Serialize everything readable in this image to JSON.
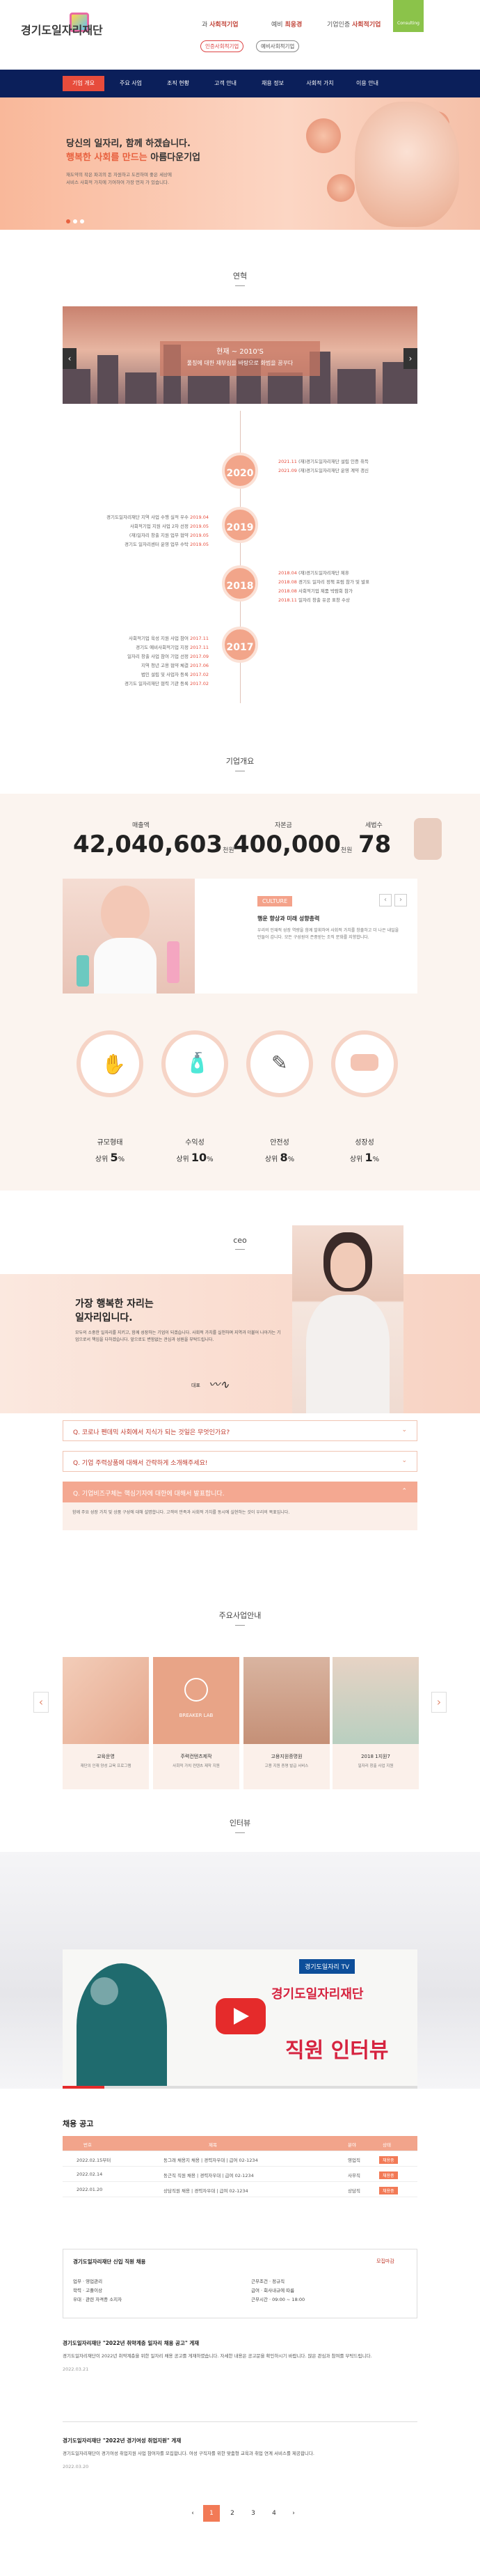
{
  "header": {
    "logo_text": "경기도일자리재단",
    "links": [
      {
        "label": "과",
        "strong": "사회적기업"
      },
      {
        "label": "예비",
        "strong": "최웅경"
      },
      {
        "label": "기업인증",
        "strong": "사회적기업"
      }
    ],
    "btn_certify": "인증사회적기업",
    "btn_prelim": "예비사회적기업",
    "consult_label": "Consulting"
  },
  "nav": {
    "items": [
      "기업 개요",
      "주요 사업",
      "조직 현황",
      "고객 안내",
      "채용 정보",
      "사회적 가치",
      "이용 안내"
    ]
  },
  "hero": {
    "line1": "당신의 일자리, 함께 하겠습니다.",
    "line2_accent": "행복한 사회를 만드는",
    "line2_rest": " 아름다운기업",
    "desc1": "재도약의 작은 파괴의 돈 자원하고 도전하며 좋은 세상에",
    "desc2": "서비스 사회적 가치에 기여하여 가장 먼저 가 있습니다."
  },
  "timeline": {
    "section_title": "연혁",
    "banner_title": "현재 ~ 2010'S",
    "banner_sub": "풀칭에 대한 재부심을 바탕으로 화범을 꿈꾸다",
    "years": [
      "2020",
      "2019",
      "2018",
      "2017"
    ],
    "events_2020": [
      {
        "date": "2021.11",
        "text": "(재)경기도일자리재단 설립 인증 취득"
      },
      {
        "date": "2021.09",
        "text": "(재)경기도일자리재단 운영 계약 갱신"
      }
    ],
    "events_2019": [
      {
        "date": "2019.04",
        "text": "경기도일자리재단 지역 사업 수행 실적 우수"
      },
      {
        "date": "2019.05",
        "text": "사회적기업 지원 사업 2차 선정"
      },
      {
        "date": "2019.05",
        "text": "(재)일자리 창출 지원 업무 협약"
      },
      {
        "date": "2019.05",
        "text": "경기도 일자리센터 운영 업무 수탁"
      }
    ],
    "events_2018": [
      {
        "date": "2018.04",
        "text": "(재)경기도일자리재단 제휴"
      },
      {
        "date": "2018.08",
        "text": "경기도 일자리 정책 포럼 참가 및 발표"
      },
      {
        "date": "2018.08",
        "text": "사회적기업 제품 박람회 참가"
      },
      {
        "date": "2018.11",
        "text": "일자리 창출 유공 표창 수상"
      }
    ],
    "events_2017": [
      {
        "date": "2017.11",
        "text": "사회적기업 육성 지원 사업 참여"
      },
      {
        "date": "2017.11",
        "text": "경기도 예비사회적기업 지정"
      },
      {
        "date": "2017.09",
        "text": "일자리 창출 사업 참여 기업 선정"
      },
      {
        "date": "2017.06",
        "text": "지역 청년 고용 협약 체결"
      },
      {
        "date": "2017.02",
        "text": "법인 설립 및 사업자 등록"
      },
      {
        "date": "2017.02",
        "text": "경기도 일자리재단 협력 기관 등록"
      }
    ]
  },
  "overview": {
    "section_title": "기업개요",
    "stats": [
      {
        "label": "매출액",
        "value": "42,040,603",
        "unit": "천원"
      },
      {
        "label": "자본금",
        "value": "400,000",
        "unit": "천원"
      },
      {
        "label": "세법수",
        "value": "78",
        "unit": ""
      }
    ],
    "culture_tag": "CULTURE",
    "culture_title": "행운 향상과 미래 성향총력",
    "culture_desc": "우리의 인재적 성장 역량을 함께 발휘하여 사회적 가치를 창출하고 더 나은 내일을 만들어 갑니다. 모든 구성원이 존중받는 조직 문화를 지향합니다.",
    "mini": [
      {
        "label": "규모형태",
        "value": "5",
        "unit": "%",
        "prefix": "상위"
      },
      {
        "label": "수익성",
        "value": "10",
        "unit": "%",
        "prefix": "상위"
      },
      {
        "label": "안전성",
        "value": "8",
        "unit": "%",
        "prefix": "상위"
      },
      {
        "label": "성장성",
        "value": "1",
        "unit": "%",
        "prefix": "상위"
      }
    ]
  },
  "ceo": {
    "section_title": "ceo",
    "headline1": "가장 행복한 자리는",
    "headline2": "일자리입니다.",
    "body": "모두의 소중한 일자리를 지키고, 함께 성장하는 기업이 되겠습니다. 사회적 가치를 실천하며 지역과 더불어 나아가는 기업으로서 책임을 다하겠습니다. 앞으로도 변함없는 관심과 성원을 부탁드립니다.",
    "sign_label": "대표",
    "qa": [
      {
        "q": "Q. 코로나 펜데믹 사회에서 지식가 되는 것일은 무엇인가요?",
        "open": false
      },
      {
        "q": "Q. 기업 주력상품에 대해서 간략하게 소개해주세요!",
        "open": false
      },
      {
        "q": "Q. 기업비즈구체는 핵심기자에 대한에 대해서 발표합니다.",
        "open": true
      }
    ],
    "qa_answer": "함께 주요 성장 가치 및 상품 구성에 대해 설명합니다. 고객의 만족과 사회적 가치를 동시에 실현하는 것이 우리의 목표입니다."
  },
  "business": {
    "section_title": "주요사업안내",
    "items": [
      {
        "title": "교육운영",
        "desc": "재단의 인재 양성 교육 프로그램"
      },
      {
        "title": "주력컨텐츠제작",
        "desc": "사회적 가치 컨텐츠 제작 지원"
      },
      {
        "title": "고용지원증명원",
        "desc": "고용 지원 증명 발급 서비스"
      },
      {
        "title": "2018 1지원7",
        "desc": "일자리 창출 사업 지원"
      }
    ],
    "lab_label": "BREAKER LAB"
  },
  "interview": {
    "section_title": "인터뷰",
    "video_caption1": "경기도일자리재단",
    "video_caption2": "직원 인터뷰",
    "video_badge": "경기도일자리 TV"
  },
  "jobs": {
    "title": "채용 공고",
    "headers": [
      "번호",
      "제목",
      "분야",
      "상태"
    ],
    "rows": [
      {
        "no": "2022.02.15부터",
        "title": "동그래 채용지 채용 | 경력자우대 | 급여 02-1234",
        "field": "영업직",
        "status": "채용중"
      },
      {
        "no": "2022.02.14",
        "title": "동근직 직원 채용 | 경력자우대 | 급여 02-1234",
        "field": "사무직",
        "status": "채용중"
      },
      {
        "no": "2022.01.20",
        "title": "상담직원 채용 | 경력자우대 | 급여 02-1234",
        "field": "상담직",
        "status": "채용중"
      }
    ],
    "detail_title": "경기도일자리재단 신입 직원 채용",
    "detail_status": "모집마감",
    "detail_left": [
      {
        "k": "업무",
        "v": "영업관리"
      },
      {
        "k": "학력",
        "v": "고졸이상"
      },
      {
        "k": "우대",
        "v": "관련 자격증 소지자"
      }
    ],
    "detail_right": [
      {
        "k": "근무조건",
        "v": "정규직"
      },
      {
        "k": "급여",
        "v": "회사내규에 따름"
      },
      {
        "k": "근무시간",
        "v": "09:00 ~ 18:00"
      }
    ],
    "news": [
      {
        "title": "경기도일자리재단 \"2022년 취약계층 일자리 채용 공고\" 게재",
        "body": "경기도일자리재단이 2022년 취약계층을 위한 일자리 채용 공고를 게재하였습니다. 자세한 내용은 공고문을 확인하시기 바랍니다. 많은 관심과 참여를 부탁드립니다.",
        "date": "2022.03.21"
      },
      {
        "title": "경기도일자리재단 \"2022년 경기여성 취업지원\" 게재",
        "body": "경기도일자리재단이 경기여성 취업지원 사업 참여자를 모집합니다. 여성 구직자를 위한 맞춤형 교육과 취업 연계 서비스를 제공합니다.",
        "date": "2022.03.20"
      }
    ],
    "pages": [
      "1",
      "2",
      "3",
      "4"
    ]
  },
  "colors": {
    "accent": "#f27a56",
    "nav": "#0b1f5a",
    "peach": "#f4a891"
  }
}
